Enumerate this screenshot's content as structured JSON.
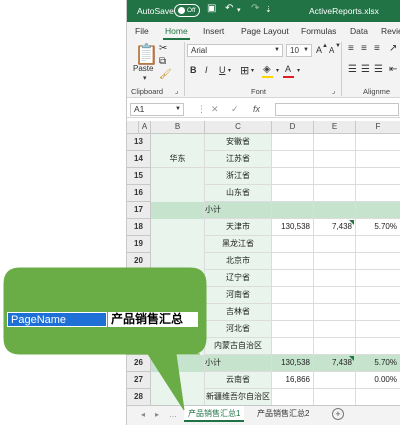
{
  "titlebar": {
    "autosave_label": "AutoSave",
    "toggle_state": "Off",
    "filename": "ActiveReports.xlsx"
  },
  "menu": [
    "File",
    "Home",
    "Insert",
    "Page Layout",
    "Formulas",
    "Data",
    "Revie"
  ],
  "menu_active": "Home",
  "ribbon": {
    "paste_label": "Paste",
    "font_name": "Arial",
    "font_size": "10",
    "group_clipboard": "Clipboard",
    "group_font": "Font",
    "group_alignment": "Alignme",
    "bold": "B",
    "italic": "I",
    "underline": "U",
    "grow_font": "A",
    "shrink_font": "A",
    "font_color": "A"
  },
  "formula_bar": {
    "name_box": "A1",
    "fx_label": "fx"
  },
  "columns": [
    "A",
    "B",
    "C",
    "D",
    "E",
    "F"
  ],
  "rows": [
    {
      "num": "13",
      "b": "",
      "c": "安徽省",
      "d": "",
      "e": "",
      "f": ""
    },
    {
      "num": "14",
      "b": "华东",
      "c": "江苏省",
      "d": "",
      "e": "",
      "f": ""
    },
    {
      "num": "15",
      "b": "",
      "c": "浙江省",
      "d": "",
      "e": "",
      "f": ""
    },
    {
      "num": "16",
      "b": "",
      "c": "山东省",
      "d": "",
      "e": "",
      "f": ""
    },
    {
      "num": "17",
      "b": "",
      "c": "小计",
      "d": "",
      "e": "",
      "f": ""
    },
    {
      "num": "18",
      "b": "",
      "c": "天津市",
      "d": "130,538",
      "e": "7,438",
      "f": "5.70%"
    },
    {
      "num": "19",
      "b": "",
      "c": "黑龙江省",
      "d": "",
      "e": "",
      "f": ""
    },
    {
      "num": "20",
      "b": "",
      "c": "北京市",
      "d": "",
      "e": "",
      "f": ""
    },
    {
      "num": "21",
      "b": "",
      "c": "辽宁省",
      "d": "",
      "e": "",
      "f": ""
    },
    {
      "num": "22",
      "b": "",
      "c": "河南省",
      "d": "",
      "e": "",
      "f": ""
    },
    {
      "num": "23",
      "b": "",
      "c": "吉林省",
      "d": "",
      "e": "",
      "f": ""
    },
    {
      "num": "24",
      "b": "",
      "c": "河北省",
      "d": "",
      "e": "",
      "f": ""
    },
    {
      "num": "25",
      "b": "",
      "c": "内蒙古自治区",
      "d": "",
      "e": "",
      "f": ""
    },
    {
      "num": "26",
      "b": "",
      "c": "小计",
      "d": "130,538",
      "e": "7,438",
      "f": "5.70%"
    },
    {
      "num": "27",
      "b": "",
      "c": "云南省",
      "d": "16,866",
      "e": "",
      "f": "0.00%"
    },
    {
      "num": "28",
      "b": "",
      "c": "新疆维吾尔自治区",
      "d": "",
      "e": "",
      "f": ""
    }
  ],
  "sheet_tabs": [
    "产品销售汇总1",
    "产品销售汇总2"
  ],
  "active_tab": "产品销售汇总1",
  "callout": {
    "key": "PageName",
    "value": "产品销售汇总",
    "fill_color": "#6aac46"
  },
  "colors": {
    "brand": "#217346",
    "subtotal": "#c6e4cd",
    "province_bg": "#e9f5ec",
    "highlight": "#1f70d6"
  }
}
